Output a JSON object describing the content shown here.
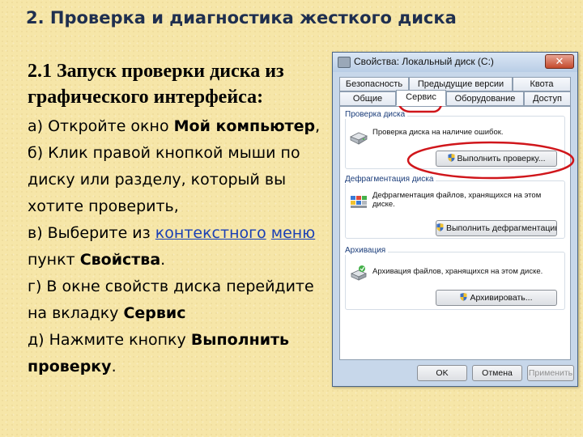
{
  "slide": {
    "title": "2. Проверка и диагностика жесткого диска",
    "subheading": "2.1 Запуск проверки диска из графического интерфейса:",
    "steps": {
      "a_text": "а) Откройте окно ",
      "a_bold": "Мой компьютер",
      "a_end": ",",
      "b_text": "б) Клик правой кнопкой мыши по диску или разделу, который вы хотите проверить,",
      "c_text": "в) Выберите из ",
      "c_link1": "контекстного",
      "c_link2": "меню",
      "c_text2": " пункт ",
      "c_bold": "Свойства",
      "c_end": ".",
      "d_text": "г)  В окне свойств диска перейдите на вкладку ",
      "d_bold": "Сервис",
      "e_text": "д) Нажмите кнопку ",
      "e_bold": "Выполнить проверку",
      "e_end": "."
    }
  },
  "dialog": {
    "title": "Свойства: Локальный диск (C:)",
    "close_label": "✕",
    "tabs_row1": [
      "Безопасность",
      "Предыдущие версии",
      "Квота"
    ],
    "tabs_row2": [
      "Общие",
      "Сервис",
      "Оборудование",
      "Доступ"
    ],
    "active_tab": "Сервис",
    "groups": {
      "check": {
        "title": "Проверка диска",
        "text": "Проверка диска на наличие ошибок.",
        "button": "Выполнить проверку..."
      },
      "defrag": {
        "title": "Дефрагментация диска",
        "text": "Дефрагментация файлов, хранящихся на этом диске.",
        "button": "Выполнить дефрагментацию..."
      },
      "backup": {
        "title": "Архивация",
        "text": "Архивация файлов, хранящихся на этом диске.",
        "button": "Архивировать..."
      }
    },
    "footer": {
      "ok": "OK",
      "cancel": "Отмена",
      "apply": "Применить"
    }
  },
  "colors": {
    "background": "#f6e6a8",
    "title": "#1f2f4f",
    "link": "#1a3fb5",
    "annotation": "#d0161b",
    "dialog": "#c7d7ea"
  },
  "icons": {
    "window": "drive-icon",
    "check": "hard-drive-icon",
    "defrag": "defrag-icon",
    "backup": "backup-icon",
    "shield": "uac-shield-icon"
  }
}
